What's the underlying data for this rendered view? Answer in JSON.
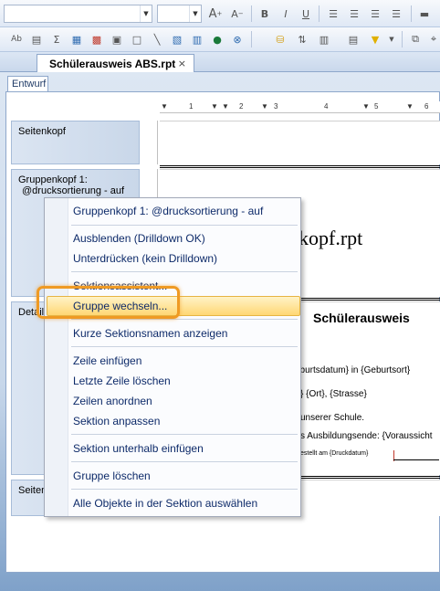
{
  "toolbar": {
    "font_name_value": "",
    "font_size_value": "",
    "grow_font_label": "A",
    "shrink_font_label": "A",
    "bold_label": "B",
    "italic_label": "I",
    "underline_label": "U",
    "sigma_label": "Σ",
    "grow_font_sup": "+",
    "shrink_font_sup": "−"
  },
  "tab": {
    "document_title": "Schülerausweis ABS.rpt",
    "close_glyph": "×"
  },
  "design_tab_label": "Entwurf",
  "sections": {
    "page_header": "Seitenkopf",
    "group_header_line1": "Gruppenkopf 1:",
    "group_header_line2": "@drucksortierung - auf",
    "details": "Details",
    "page_footer": "Seitenfuß"
  },
  "report": {
    "big_title": "kopf.rpt",
    "heading": "Schülerausweis",
    "line1": "eburtsdatum} in {Geburtsort}",
    "line2": "} {Ort}, {Strasse}",
    "line3": "unserer Schule.",
    "line4": "s Ausbildungsende: {Voraussicht",
    "line5": "estellt am {Druckdatum}"
  },
  "ruler_numbers": [
    "1",
    "2",
    "3",
    "4",
    "5",
    "6"
  ],
  "context_menu": {
    "items": [
      "Gruppenkopf 1: @drucksortierung - auf",
      "Ausblenden (Drilldown OK)",
      "Unterdrücken (kein Drilldown)",
      "Sektionsassistent...",
      "Gruppe wechseln...",
      "Kurze Sektionsnamen anzeigen",
      "Zeile einfügen",
      "Letzte Zeile löschen",
      "Zeilen anordnen",
      "Sektion anpassen",
      "Sektion unterhalb einfügen",
      "Gruppe löschen",
      "Alle Objekte in der Sektion auswählen"
    ],
    "highlighted_item": "Gruppe wechseln..."
  },
  "colors": {
    "menu_text": "#0d2a69",
    "highlight": "#ffd774",
    "callout_ring": "#ef9a23",
    "section_label_bg": "#c9d7e9"
  }
}
